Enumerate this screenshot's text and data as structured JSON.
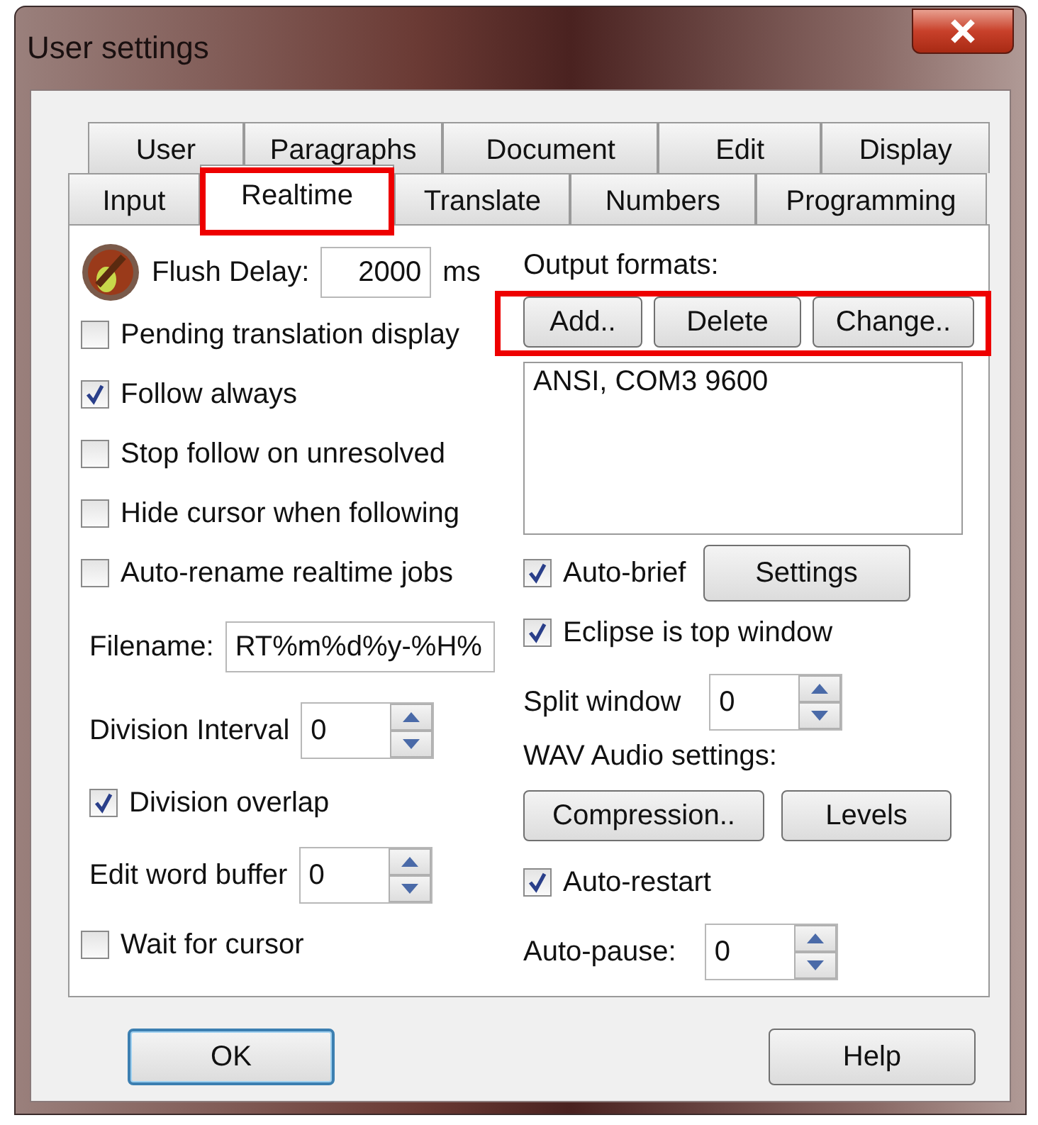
{
  "window": {
    "title": "User settings"
  },
  "tab_rows": [
    [
      {
        "label": "User",
        "selected": false,
        "highlighted": false
      },
      {
        "label": "Paragraphs",
        "selected": false,
        "highlighted": false
      },
      {
        "label": "Document",
        "selected": false,
        "highlighted": false
      },
      {
        "label": "Edit",
        "selected": false,
        "highlighted": false
      },
      {
        "label": "Display",
        "selected": false,
        "highlighted": false
      }
    ],
    [
      {
        "label": "Input",
        "selected": false,
        "highlighted": false
      },
      {
        "label": "Realtime",
        "selected": true,
        "highlighted": true
      },
      {
        "label": "Translate",
        "selected": false,
        "highlighted": false
      },
      {
        "label": "Numbers",
        "selected": false,
        "highlighted": false
      },
      {
        "label": "Programming",
        "selected": false,
        "highlighted": false
      }
    ]
  ],
  "left": [
    {
      "kind": "flush",
      "label": "Flush Delay:",
      "value": "2000",
      "unit": "ms"
    },
    {
      "kind": "checkbox",
      "label": "Pending translation display",
      "checked": false
    },
    {
      "kind": "checkbox",
      "label": "Follow always",
      "checked": true
    },
    {
      "kind": "checkbox",
      "label": "Stop follow on unresolved",
      "checked": false
    },
    {
      "kind": "checkbox",
      "label": "Hide cursor when following",
      "checked": false
    },
    {
      "kind": "checkbox",
      "label": "Auto-rename realtime jobs",
      "checked": false
    },
    {
      "kind": "field",
      "label": "Filename:",
      "value": "RT%m%d%y-%H%"
    },
    {
      "kind": "spinner",
      "label": "Division Interval",
      "value": "0"
    },
    {
      "kind": "checkbox",
      "label": "Division overlap",
      "checked": true
    },
    {
      "kind": "spinner",
      "label": "Edit word buffer",
      "value": "0"
    },
    {
      "kind": "checkbox",
      "label": "Wait for cursor",
      "checked": false
    }
  ],
  "right": [
    {
      "kind": "heading",
      "label": "Output formats:"
    },
    {
      "kind": "buttons",
      "highlighted": true,
      "buttons": [
        "Add..",
        "Delete",
        "Change.."
      ]
    },
    {
      "kind": "list",
      "items": [
        "ANSI, COM3 9600"
      ]
    },
    {
      "kind": "checkbox_button",
      "label": "Auto-brief",
      "checked": true,
      "button": "Settings"
    },
    {
      "kind": "checkbox",
      "label": "Eclipse is top window",
      "checked": true
    },
    {
      "kind": "spinner",
      "label": "Split window",
      "value": "0"
    },
    {
      "kind": "heading",
      "label": "WAV Audio settings:"
    },
    {
      "kind": "buttons",
      "highlighted": false,
      "buttons": [
        "Compression..",
        "Levels"
      ]
    },
    {
      "kind": "checkbox",
      "label": "Auto-restart",
      "checked": true
    },
    {
      "kind": "spinner",
      "label": "Auto-pause:",
      "value": "0"
    }
  ],
  "footer_buttons": [
    {
      "label": "OK",
      "default": true
    },
    {
      "label": "Help",
      "default": false
    }
  ]
}
